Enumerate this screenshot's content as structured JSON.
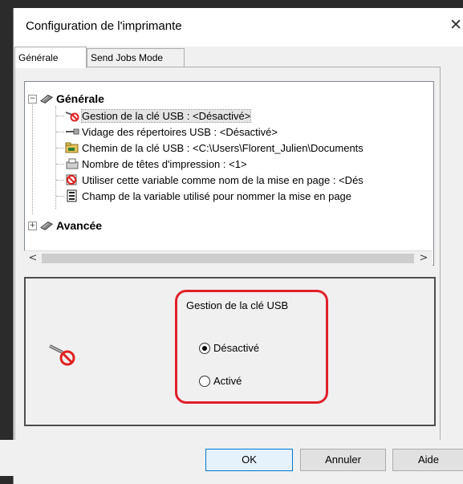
{
  "window": {
    "title": "Configuration de l'imprimante"
  },
  "tabs": [
    {
      "label": "Générale",
      "active": true
    },
    {
      "label": "Send Jobs Mode",
      "active": false
    }
  ],
  "tree": {
    "groups": [
      {
        "label": "Générale",
        "expander": "−",
        "items": [
          {
            "label": "Gestion de la clé USB : <Désactivé>",
            "icon": "usb-disabled-icon",
            "selected": true
          },
          {
            "label": "Vidage des répertoires USB : <Désactivé>",
            "icon": "usb-icon"
          },
          {
            "label": "Chemin de la clé USB : <C:\\Users\\Florent_Julien\\Documents",
            "icon": "folder-icon"
          },
          {
            "label": "Nombre de têtes d'impression : <1>",
            "icon": "printhead-icon"
          },
          {
            "label": "Utiliser cette variable comme nom de la mise en page : <Dés",
            "icon": "variable-disabled-icon"
          },
          {
            "label": "Champ de la variable utilisé pour nommer la mise en page",
            "icon": "field-icon"
          }
        ]
      },
      {
        "label": "Avancée",
        "expander": "+"
      }
    ]
  },
  "scrollbar": {
    "left": "<",
    "right": ">"
  },
  "detail": {
    "group_title": "Gestion de la clé USB",
    "options": [
      {
        "label": "Désactivé",
        "checked": true
      },
      {
        "label": "Activé",
        "checked": false
      }
    ],
    "highlight_color": "#e0202a"
  },
  "buttons": {
    "ok": "OK",
    "cancel": "Annuler",
    "help": "Aide"
  },
  "close_glyph": "✕"
}
